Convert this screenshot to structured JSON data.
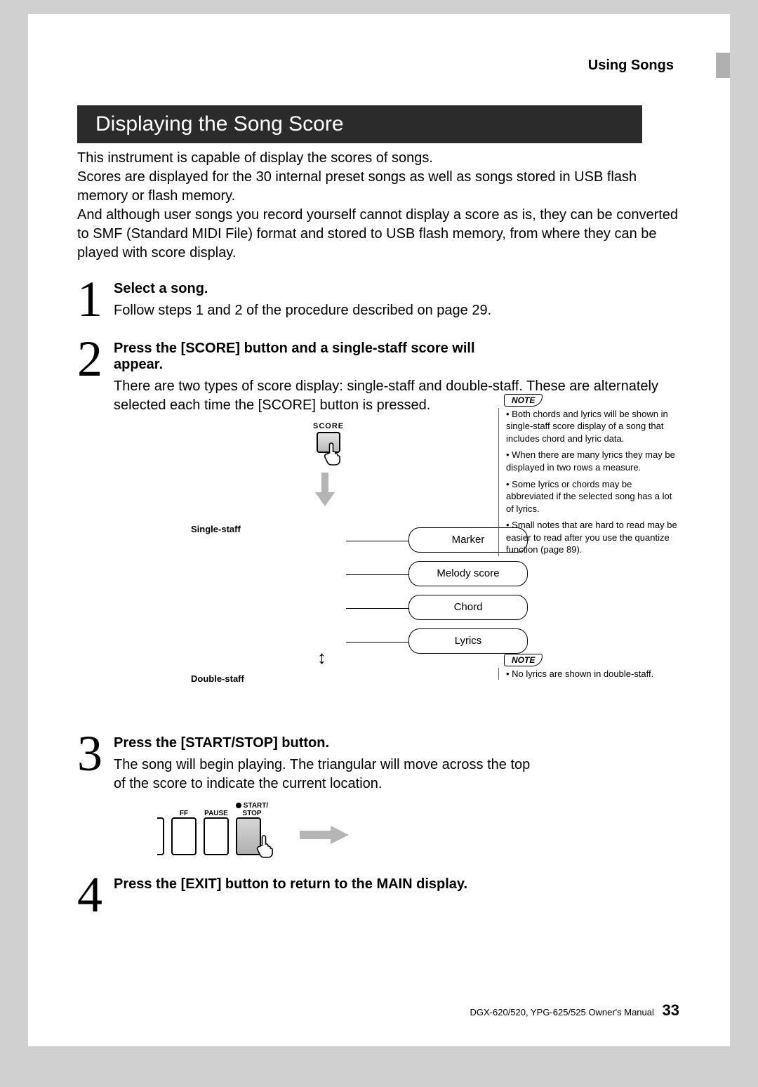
{
  "header": {
    "section": "Using Songs"
  },
  "title": "Displaying the Song Score",
  "intro": "This instrument is capable of display the scores of songs.\nScores are displayed for the 30 internal preset songs as well as songs stored in USB ﬂash memory or ﬂash memory.\nAnd although user songs you record yourself cannot display a score as is, they can be converted to SMF (Standard MIDI File) format and stored to USB ﬂash memory, from where they can be played with score display.",
  "steps": [
    {
      "num": "1",
      "head": "Select a song.",
      "text": "Follow steps 1 and 2 of the procedure described on page 29."
    },
    {
      "num": "2",
      "head": "Press the [SCORE] button and a single-staff score will appear.",
      "text": "There are two types of score display: single-staff and double-staff. These are alternately selected each time the [SCORE] button is pressed."
    },
    {
      "num": "3",
      "head": "Press the [START/STOP] button.",
      "text": "The song will begin playing. The triangular will move across the top of the score to indicate the current location."
    },
    {
      "num": "4",
      "head": "Press the [EXIT] button to return to the MAIN display.",
      "text": ""
    }
  ],
  "diagram": {
    "score_label": "SCORE",
    "single_staff": "Single-staff",
    "double_staff": "Double-staff",
    "callouts": [
      "Marker",
      "Melody score",
      "Chord",
      "Lyrics"
    ]
  },
  "notes1": {
    "label": "NOTE",
    "items": [
      "• Both chords and lyrics will be shown in single-staff score display of a song that includes chord and lyric data.",
      "• When there are many lyrics they may be displayed in two rows a measure.",
      "• Some lyrics or chords may be abbreviated if the selected song has a lot of lyrics.",
      "• Small notes that are hard to read may be easier to read after you use the quantize function (page 89)."
    ]
  },
  "notes2": {
    "label": "NOTE",
    "items": [
      "• No lyrics are shown in double-staff."
    ]
  },
  "buttons": {
    "ff": "FF",
    "pause": "PAUSE",
    "start_stop_top": "START/",
    "start_stop_bot": "STOP"
  },
  "footer": {
    "model": "DGX-620/520, YPG-625/525  Owner's Manual",
    "page": "33"
  }
}
